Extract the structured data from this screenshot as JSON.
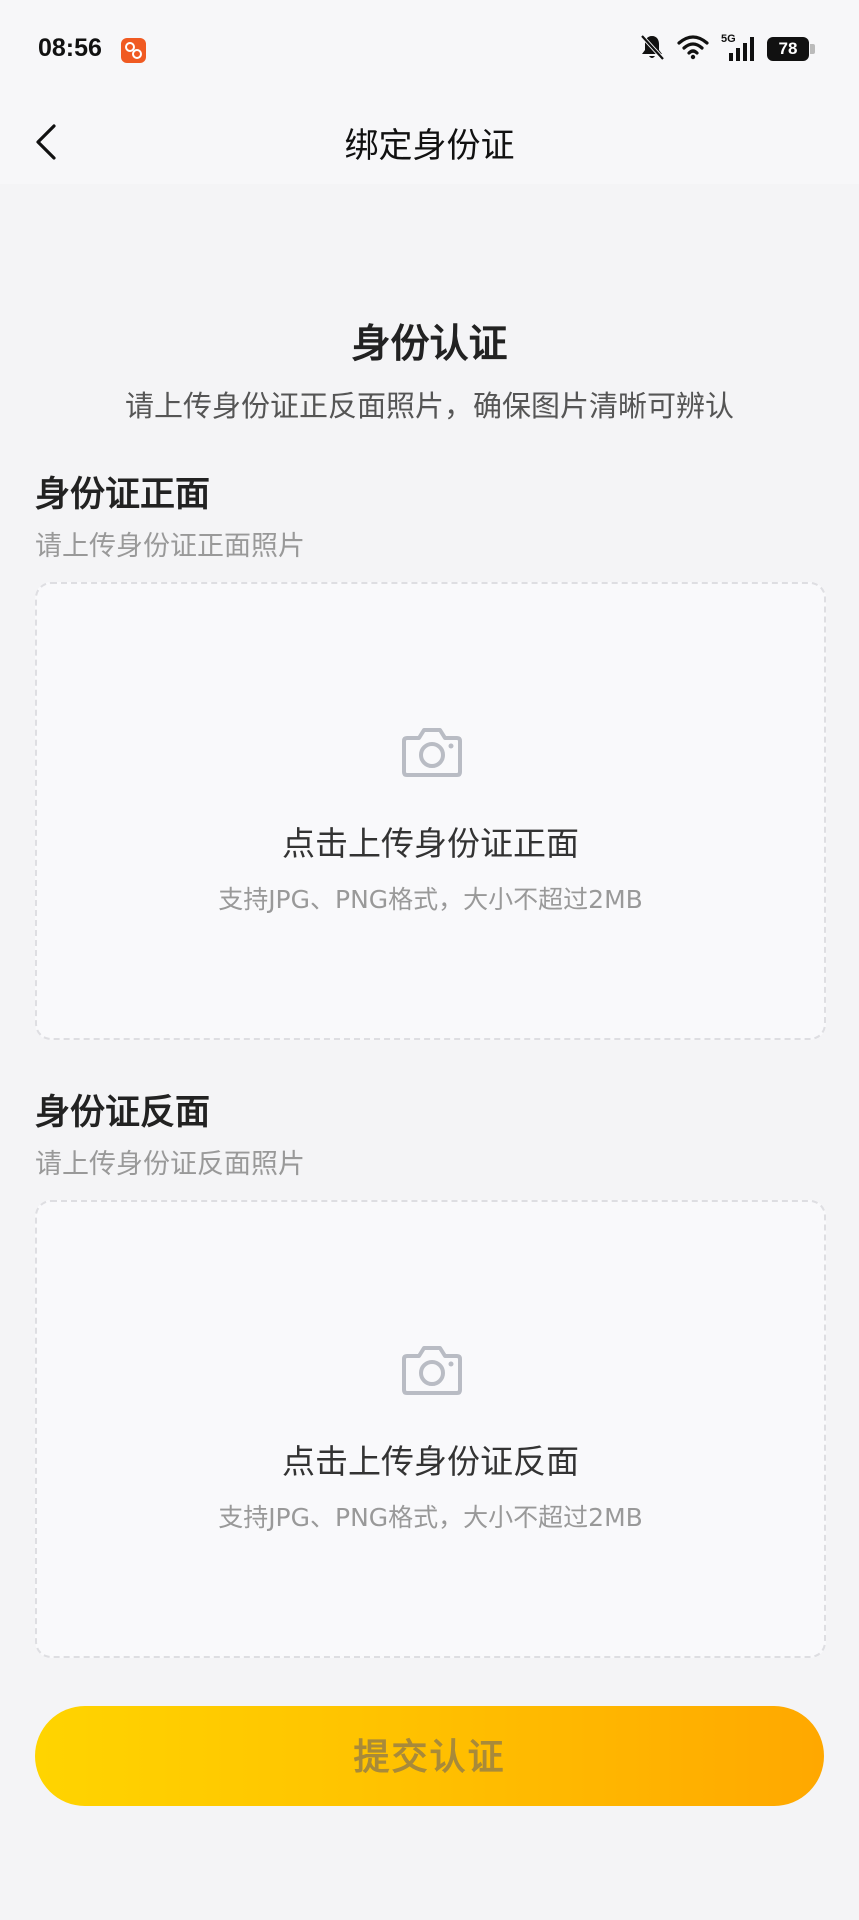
{
  "status_bar": {
    "time": "08:56",
    "battery": "78",
    "network": "5G",
    "icons": [
      "app-notification-icon",
      "bell-muted-icon",
      "wifi-icon",
      "signal-icon",
      "battery-icon"
    ]
  },
  "nav": {
    "title": "绑定身份证",
    "back_icon": "chevron-left-icon"
  },
  "header": {
    "title": "身份认证",
    "subtitle": "请上传身份证正反面照片，确保图片清晰可辨认"
  },
  "front": {
    "title": "身份证正面",
    "hint": "请上传身份证正面照片",
    "upload_label": "点击上传身份证正面",
    "format_hint": "支持JPG、PNG格式，大小不超过2MB",
    "icon": "camera-icon"
  },
  "back": {
    "title": "身份证反面",
    "hint": "请上传身份证反面照片",
    "upload_label": "点击上传身份证反面",
    "format_hint": "支持JPG、PNG格式，大小不超过2MB",
    "icon": "camera-icon"
  },
  "submit": {
    "label": "提交认证"
  },
  "colors": {
    "accent_start": "#ffd400",
    "accent_end": "#ffa800",
    "app_icon": "#f05a22"
  }
}
